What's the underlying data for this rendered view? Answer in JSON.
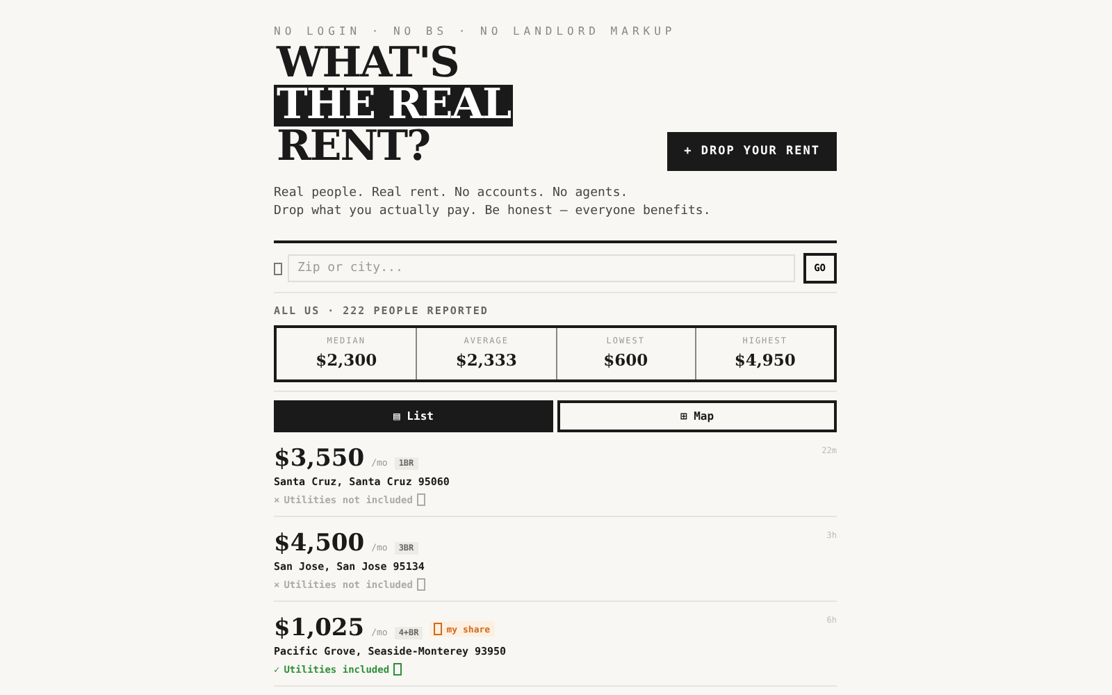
{
  "tagline": "NO LOGIN · NO BS · NO LANDLORD MARKUP",
  "headline": [
    {
      "text": "WHAT'S",
      "highlighted": false
    },
    {
      "text": "THE REAL",
      "highlighted": true
    },
    {
      "text": "RENT?",
      "highlighted": false
    }
  ],
  "cta": "+ DROP YOUR RENT",
  "intro": [
    "Real people. Real rent. No accounts. No agents.",
    "Drop what you actually pay. Be honest — everyone benefits."
  ],
  "search": {
    "placeholder": "Zip or city...",
    "button": "GO"
  },
  "scope": "ALL US · 222 PEOPLE REPORTED",
  "stats": [
    {
      "label": "MEDIAN",
      "value": "$2,300"
    },
    {
      "label": "AVERAGE",
      "value": "$2,333"
    },
    {
      "label": "LOWEST",
      "value": "$600"
    },
    {
      "label": "HIGHEST",
      "value": "$4,950"
    }
  ],
  "views": [
    {
      "icon": "▤",
      "label": "List",
      "selected": true
    },
    {
      "icon": "⊞",
      "label": "Map",
      "selected": false
    }
  ],
  "listings": [
    {
      "price": "$3,550",
      "per": "/mo",
      "beds": "1BR",
      "share": false,
      "location": "Santa Cruz, Santa Cruz 95060",
      "mark": "×",
      "utilities": "Utilities not included",
      "included": false,
      "age": "22m"
    },
    {
      "price": "$4,500",
      "per": "/mo",
      "beds": "3BR",
      "share": false,
      "location": "San Jose, San Jose 95134",
      "mark": "×",
      "utilities": "Utilities not included",
      "included": false,
      "age": "3h"
    },
    {
      "price": "$1,025",
      "per": "/mo",
      "beds": "4+BR",
      "share": true,
      "share_label": "my share",
      "location": "Pacific Grove, Seaside-Monterey 93950",
      "mark": "✓",
      "utilities": "Utilities included",
      "included": true,
      "age": "6h"
    }
  ]
}
